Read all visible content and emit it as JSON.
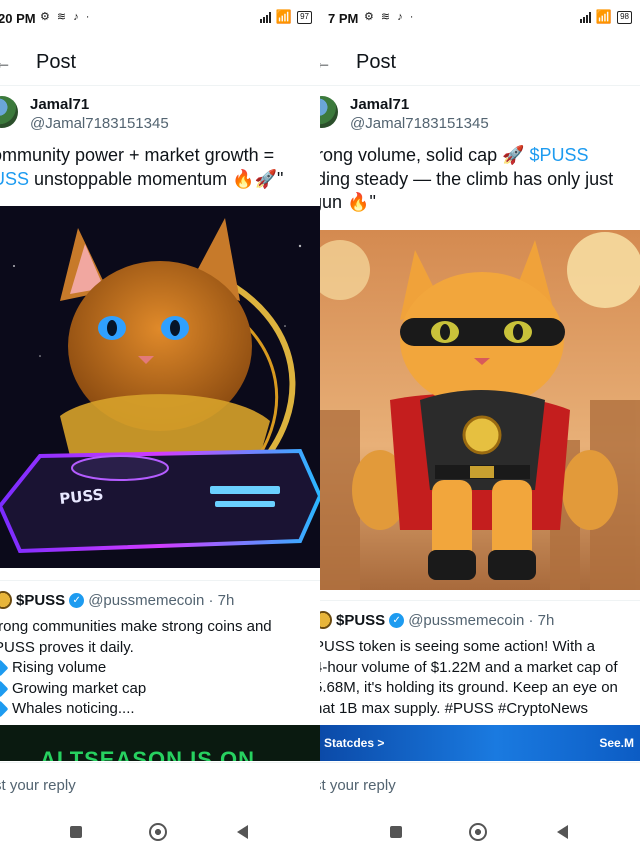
{
  "panels": [
    {
      "status": {
        "time": "20 PM",
        "icons": "⚙ ≋ ♪ ·",
        "battery": "97"
      },
      "header": {
        "title": "Post",
        "back": "←"
      },
      "post": {
        "display_name": "Jamal71",
        "handle": "@Jamal7183151345",
        "line1": "ommunity power + market growth =",
        "line2_tag": "USS",
        "line2_rest": " unstoppable momentum 🔥🚀\"",
        "image_label": "PUSS"
      },
      "quote": {
        "name": "$PUSS",
        "handle": "@pussmemecoin · 7h",
        "line1": "trong communities make strong coins and",
        "line2": "PUSS proves it daily.",
        "bullets": [
          "Rising volume",
          "Growing market cap",
          "Whales noticing...."
        ],
        "thumb_text": "ALTSEASON IS ON"
      },
      "reply_placeholder": "st your reply"
    },
    {
      "status": {
        "time": "7 PM",
        "icons": "⚙ ≋ ♪ ·",
        "battery": "98"
      },
      "header": {
        "title": "Post",
        "back": "←"
      },
      "post": {
        "display_name": "Jamal71",
        "handle": "@Jamal7183151345",
        "line1_pre": "trong volume, solid cap 🚀 ",
        "line1_tag": "$PUSS",
        "line2": "lding steady — the climb has only just",
        "line3": "gun 🔥\""
      },
      "quote": {
        "name": "$PUSS",
        "handle": "@pussmemecoin · 7h",
        "lines": [
          "PUSS token is seeing some action! With a",
          "4-hour volume of $1.22M and a market cap of",
          "5.68M, it's holding its ground. Keep an eye on",
          "hat 1B max supply. #PUSS #CryptoNews"
        ],
        "thumb_left": "Statcdes  >",
        "thumb_right": "See.M"
      },
      "reply_placeholder": "st your reply"
    }
  ],
  "colors": {
    "accent": "#1d9bf0",
    "text": "#0f1419",
    "muted": "#536471"
  }
}
